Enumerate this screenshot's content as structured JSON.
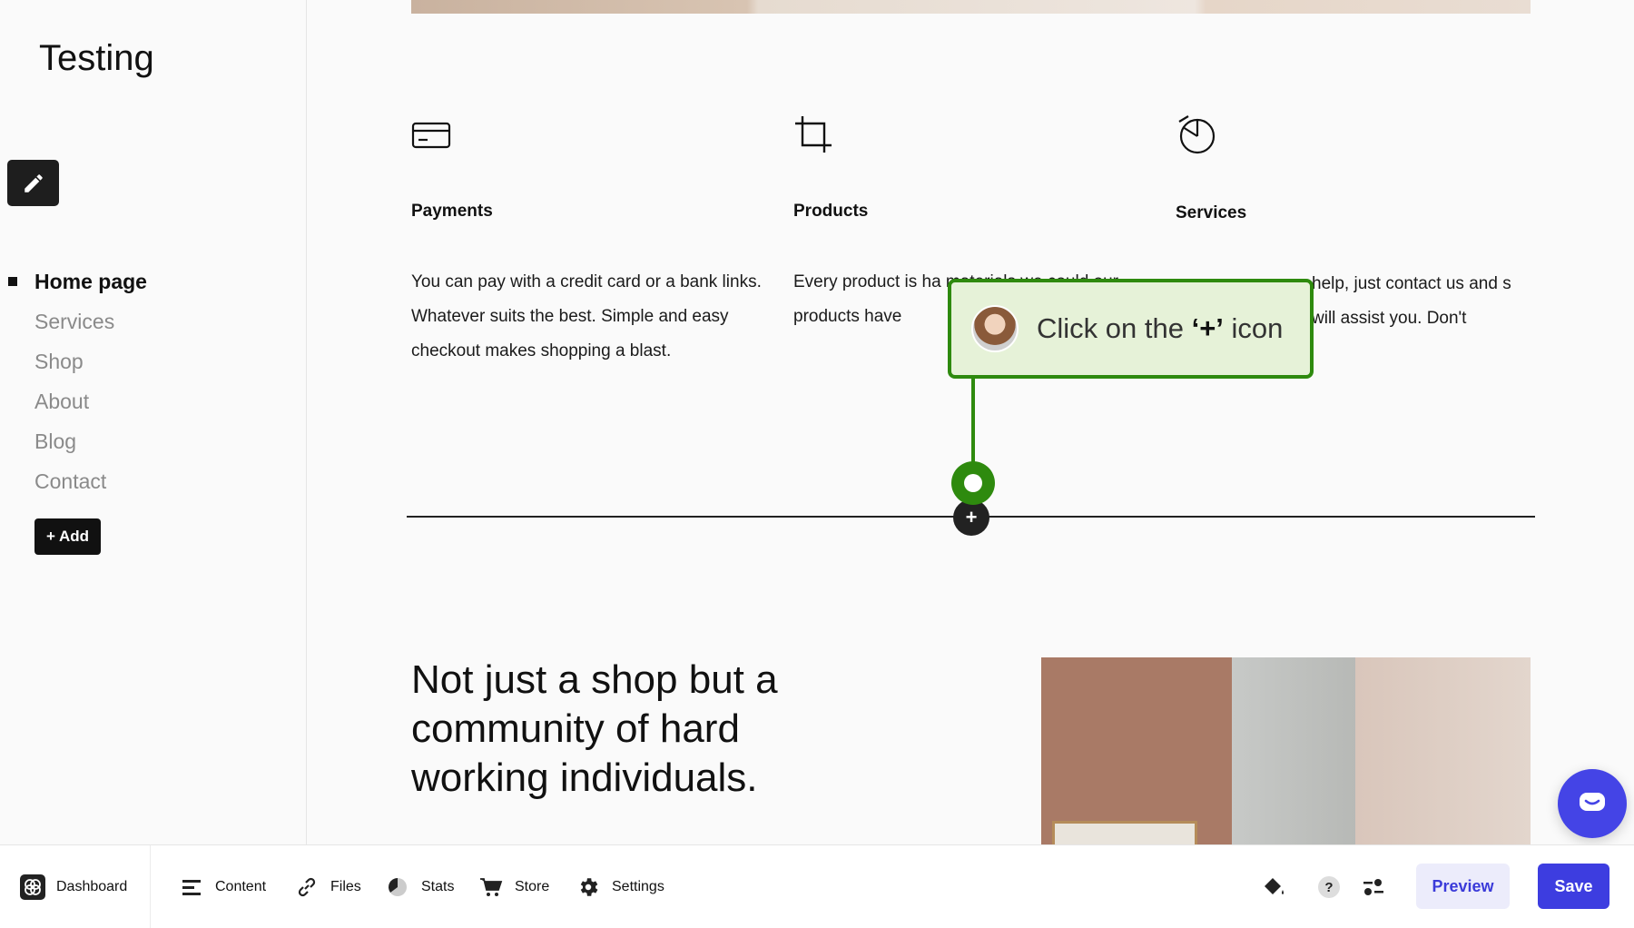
{
  "site": {
    "title": "Testing"
  },
  "sidebar": {
    "items": [
      {
        "label": "Home page",
        "active": true
      },
      {
        "label": "Services"
      },
      {
        "label": "Shop"
      },
      {
        "label": "About"
      },
      {
        "label": "Blog"
      },
      {
        "label": "Contact"
      }
    ],
    "add_label": "+ Add"
  },
  "features": [
    {
      "icon": "credit-card-icon",
      "title": "Payments",
      "text": "You can pay with a credit card or a bank links. Whatever suits the best. Simple and easy checkout makes shopping a blast."
    },
    {
      "icon": "crop-icon",
      "title": "Products",
      "text": "Every product is ha materials we could our products have"
    },
    {
      "icon": "pie-chart-icon",
      "title": "Services",
      "text": "help, just contact us and s will assist you. Don't"
    }
  ],
  "divider": {
    "add_symbol": "+"
  },
  "section": {
    "headline": "Not just a shop but a community of hard working individuals."
  },
  "tooltip": {
    "text_before": "Click on the ",
    "text_strong": "‘+’",
    "text_after": " icon"
  },
  "toolbar": {
    "dashboard": "Dashboard",
    "content": "Content",
    "files": "Files",
    "stats": "Stats",
    "store": "Store",
    "settings": "Settings",
    "help": "?",
    "preview": "Preview",
    "save": "Save"
  },
  "colors": {
    "accent": "#3d3de0",
    "tooltip_border": "#2e8a0e",
    "tooltip_bg": "#e6f2d8"
  }
}
